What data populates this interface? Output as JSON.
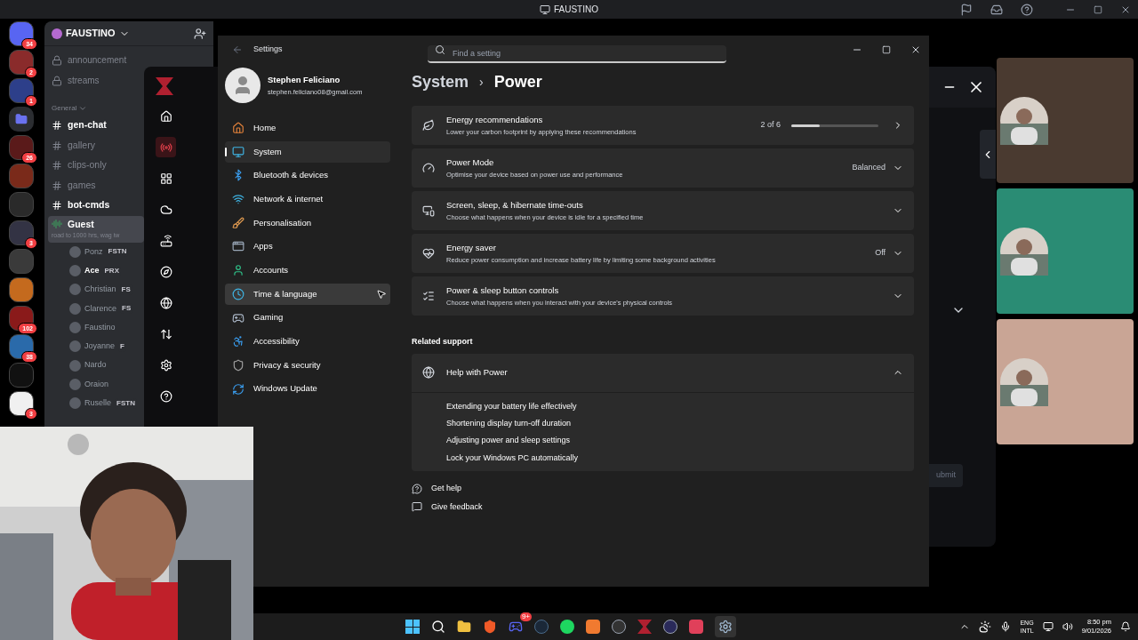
{
  "top_bar": {
    "title": "FAUSTINO"
  },
  "servers": [
    {
      "kind": "picture",
      "badge": "34"
    },
    {
      "kind": "picture",
      "badge": "2"
    },
    {
      "kind": "picture",
      "badge": "1"
    },
    {
      "kind": "folder"
    },
    {
      "kind": "picture",
      "badge": "26"
    },
    {
      "kind": "picture"
    },
    {
      "kind": "picture"
    },
    {
      "kind": "picture",
      "badge": "3"
    },
    {
      "kind": "picture"
    },
    {
      "kind": "picture"
    },
    {
      "kind": "picture",
      "badge": "102"
    },
    {
      "kind": "picture",
      "badge": "38"
    },
    {
      "kind": "picture"
    },
    {
      "kind": "picture",
      "badge": "3"
    }
  ],
  "discord": {
    "server_name": "FAUSTINO",
    "locked_channels": [
      "announcement",
      "streams"
    ],
    "category": {
      "name": "General",
      "expanded": true,
      "channels": [
        {
          "name": "gen-chat",
          "unread": true
        },
        {
          "name": "gallery",
          "unread": false
        },
        {
          "name": "clips-only",
          "unread": false
        },
        {
          "name": "games",
          "unread": false
        },
        {
          "name": "bot-cmds",
          "unread": true
        }
      ]
    },
    "voice_channel": {
      "name": "Guest",
      "status": "road to 1000 hrs, wag iw",
      "selected": true,
      "members": [
        {
          "name": "Ponz",
          "tag": "FSTN",
          "highlighted": false
        },
        {
          "name": "Ace",
          "tag": "PRX",
          "highlighted": true
        },
        {
          "name": "Christian",
          "tag": "FS",
          "highlighted": false
        },
        {
          "name": "Clarence",
          "tag": "FS",
          "highlighted": false
        },
        {
          "name": "Faustino",
          "highlighted": false
        },
        {
          "name": "Joyanne",
          "tag": "F",
          "highlighted": false
        },
        {
          "name": "Nardo",
          "highlighted": false
        },
        {
          "name": "Oraion",
          "highlighted": false
        },
        {
          "name": "Ruselle",
          "tag": "FSTN",
          "highlighted": false
        }
      ]
    }
  },
  "overlay_nav": [
    {
      "kind": "home",
      "selected": false
    },
    {
      "kind": "broadcast",
      "selected": true
    },
    {
      "kind": "grid",
      "selected": false
    },
    {
      "kind": "cloud",
      "selected": false
    },
    {
      "kind": "router",
      "selected": false
    },
    {
      "kind": "compass",
      "selected": false
    },
    {
      "kind": "globe",
      "selected": false
    },
    {
      "kind": "transfer",
      "selected": false
    },
    {
      "kind": "settings",
      "selected": false
    },
    {
      "kind": "help",
      "selected": false
    }
  ],
  "settings": {
    "window_title": "Settings",
    "user": {
      "name": "Stephen Feliciano",
      "email": "stephen.feliciano08@gmail.com"
    },
    "nav": [
      {
        "kind": "home",
        "label": "Home",
        "selected": false,
        "hovered": false
      },
      {
        "kind": "system",
        "label": "System",
        "selected": true,
        "hovered": false
      },
      {
        "kind": "bluetooth",
        "label": "Bluetooth & devices",
        "selected": false,
        "hovered": false
      },
      {
        "kind": "network",
        "label": "Network & internet",
        "selected": false,
        "hovered": false
      },
      {
        "kind": "brush",
        "label": "Personalisation",
        "selected": false,
        "hovered": false
      },
      {
        "kind": "apps",
        "label": "Apps",
        "selected": false,
        "hovered": false
      },
      {
        "kind": "accounts",
        "label": "Accounts",
        "selected": false,
        "hovered": false
      },
      {
        "kind": "time",
        "label": "Time & language",
        "selected": false,
        "hovered": true
      },
      {
        "kind": "gaming",
        "label": "Gaming",
        "selected": false,
        "hovered": false
      },
      {
        "kind": "accessibility",
        "label": "Accessibility",
        "selected": false,
        "hovered": false
      },
      {
        "kind": "privacy",
        "label": "Privacy & security",
        "selected": false,
        "hovered": false
      },
      {
        "kind": "update",
        "label": "Windows Update",
        "selected": false,
        "hovered": false
      }
    ],
    "search": {
      "placeholder": "Find a setting"
    },
    "breadcrumb": {
      "parent": "System",
      "separator": "›",
      "current": "Power"
    },
    "cards": [
      {
        "kind": "progress",
        "title": "Energy recommendations",
        "subtitle": "Lower your carbon footprint by applying these recommendations",
        "value": "2 of 6",
        "level": 0.33
      },
      {
        "kind": "dropdown",
        "title": "Power Mode",
        "subtitle": "Optimise your device based on power use and performance",
        "value": "Balanced"
      },
      {
        "kind": "expand",
        "title": "Screen, sleep, & hibernate time-outs",
        "subtitle": "Choose what happens when your device is idle for a specified time"
      },
      {
        "kind": "dropdown",
        "title": "Energy saver",
        "subtitle": "Reduce power consumption and increase battery life by limiting some background activities",
        "value": "Off"
      },
      {
        "kind": "expand",
        "title": "Power & sleep button controls",
        "subtitle": "Choose what happens when you interact with your device's physical controls"
      }
    ],
    "related": {
      "heading": "Related support",
      "title": "Help with Power",
      "expanded": true,
      "links": [
        "Extending your battery life effectively",
        "Shortening display turn-off duration",
        "Adjusting power and sleep settings",
        "Lock your Windows PC automatically"
      ]
    },
    "footer": [
      {
        "kind": "help",
        "label": "Get help"
      },
      {
        "kind": "feedback",
        "label": "Give feedback"
      }
    ]
  },
  "right_panel": {
    "button": "ubmit"
  },
  "profile_cards": [
    {
      "color": "#4a3a30"
    },
    {
      "color": "#2a8c74"
    },
    {
      "color": "#c9a595"
    }
  ],
  "webcam": {
    "kind": "picture"
  },
  "taskbar": {
    "discord_badge": "9+",
    "language": "ENG",
    "layout": "INTL",
    "time": "8:50 pm",
    "date": "9/01/2026"
  }
}
